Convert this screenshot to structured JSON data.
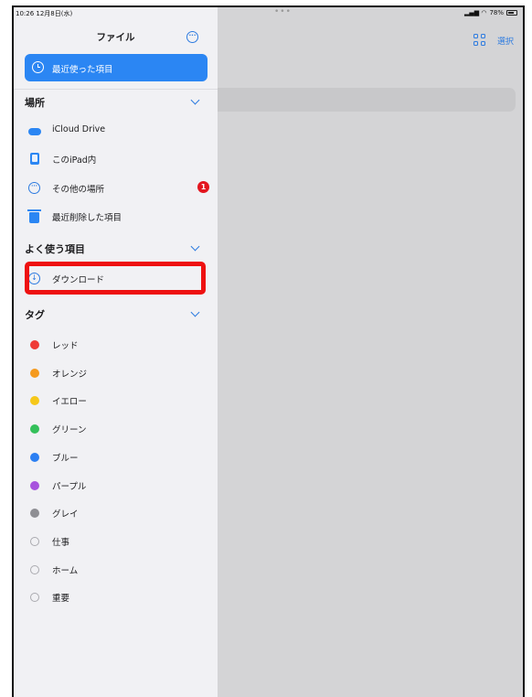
{
  "status_bar": {
    "time": "10:26  12月8日(水)",
    "dots": "•••",
    "battery_text": "78%"
  },
  "sidebar": {
    "title": "ファイル",
    "recent_label": "最近使った項目",
    "locations_header": "場所",
    "locations": [
      {
        "label": "iCloud Drive",
        "icon": "icloud-icon"
      },
      {
        "label": "このiPad内",
        "icon": "ipad-icon"
      },
      {
        "label": "その他の場所",
        "icon": "more-circle-icon",
        "badge": "1"
      },
      {
        "label": "最近削除した項目",
        "icon": "trash-icon"
      }
    ],
    "favorites_header": "よく使う項目",
    "favorites": [
      {
        "label": "ダウンロード",
        "icon": "download-icon"
      }
    ],
    "tags_header": "タグ",
    "tags": [
      {
        "label": "レッド",
        "color": "#ef3b36"
      },
      {
        "label": "オレンジ",
        "color": "#f59a1e"
      },
      {
        "label": "イエロー",
        "color": "#f6c81a"
      },
      {
        "label": "グリーン",
        "color": "#34c05a"
      },
      {
        "label": "ブルー",
        "color": "#2b7ff2"
      },
      {
        "label": "パープル",
        "color": "#a753dd"
      },
      {
        "label": "グレイ",
        "color": "#8e8e93"
      },
      {
        "label": "仕事",
        "color": ""
      },
      {
        "label": "ホーム",
        "color": ""
      },
      {
        "label": "重要",
        "color": ""
      }
    ]
  },
  "toolbar": {
    "select_label": "選択"
  },
  "colors": {
    "accent": "#2b86f3",
    "highlight": "#ee1111"
  }
}
